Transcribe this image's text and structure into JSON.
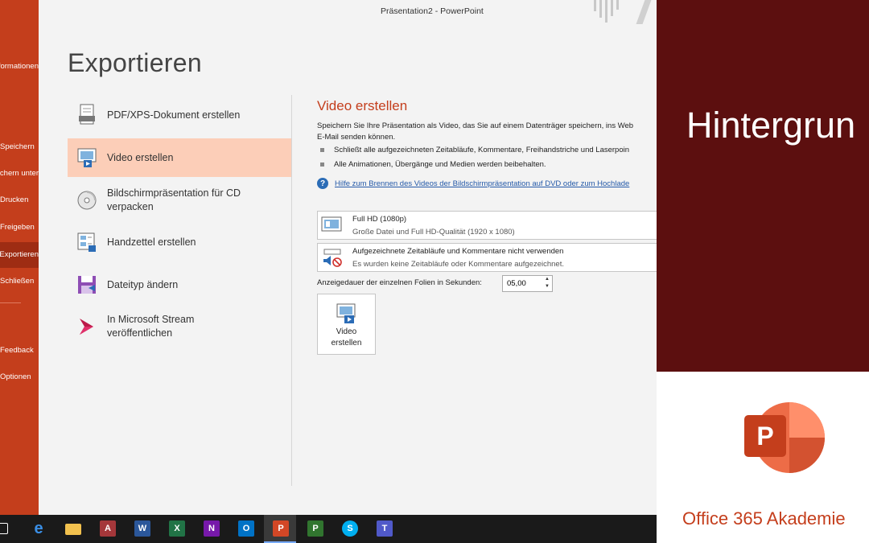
{
  "window": {
    "title": "Präsentation2  -  PowerPoint"
  },
  "sidebar": {
    "items": [
      {
        "label": "Informationen"
      },
      {
        "label": "Speichern"
      },
      {
        "label": "Speichern unter"
      },
      {
        "label": "Drucken"
      },
      {
        "label": "Freigeben"
      },
      {
        "label": "Exportieren"
      },
      {
        "label": "Schließen"
      },
      {
        "label": "Feedback"
      },
      {
        "label": "Optionen"
      }
    ]
  },
  "page": {
    "title": "Exportieren"
  },
  "export_options": [
    {
      "label": "PDF/XPS-Dokument erstellen",
      "icon": "pdf-document-icon"
    },
    {
      "label": "Video erstellen",
      "icon": "video-icon"
    },
    {
      "label": "Bildschirmpräsentation für CD verpacken",
      "icon": "cd-icon"
    },
    {
      "label": "Handzettel erstellen",
      "icon": "handout-icon"
    },
    {
      "label": "Dateityp ändern",
      "icon": "save-as-type-icon"
    },
    {
      "label": "In Microsoft Stream veröffentlichen",
      "icon": "stream-icon"
    }
  ],
  "video_panel": {
    "title": "Video erstellen",
    "description_line1": "Speichern Sie Ihre Präsentation als Video, das Sie auf einem Datenträger speichern, ins Web",
    "description_line2": "E-Mail senden können.",
    "bullet1": "Schließt alle aufgezeichneten Zeitabläufe, Kommentare, Freihandstriche und Laserpoin",
    "bullet2": "Alle Animationen, Übergänge und Medien werden beibehalten.",
    "help_link": "Hilfe zum Brennen des Videos der Bildschirmpräsentation auf DVD oder zum Hochlade",
    "quality": {
      "title": "Full HD (1080p)",
      "subtitle": "Große Datei und Full HD-Qualität (1920 x 1080)"
    },
    "timings": {
      "title": "Aufgezeichnete Zeitabläufe und Kommentare nicht verwenden",
      "subtitle": "Es wurden keine Zeitabläufe oder Kommentare aufgezeichnet."
    },
    "duration_label": "Anzeigedauer der einzelnen Folien in Sekunden:",
    "duration_value": "05,00",
    "create_button_line1": "Video",
    "create_button_line2": "erstellen"
  },
  "taskbar": {
    "apps": [
      "task-view-icon",
      "edge-icon",
      "file-explorer-icon",
      "access-icon",
      "word-icon",
      "excel-icon",
      "onenote-icon",
      "outlook-icon",
      "powerpoint-icon",
      "project-icon",
      "skype-icon",
      "teams-icon"
    ]
  },
  "branding": {
    "heading": "Hintergrun",
    "name": "Office 365 Akademie",
    "accent": "#c43e1c",
    "dark_bg": "#5c0f0f"
  }
}
